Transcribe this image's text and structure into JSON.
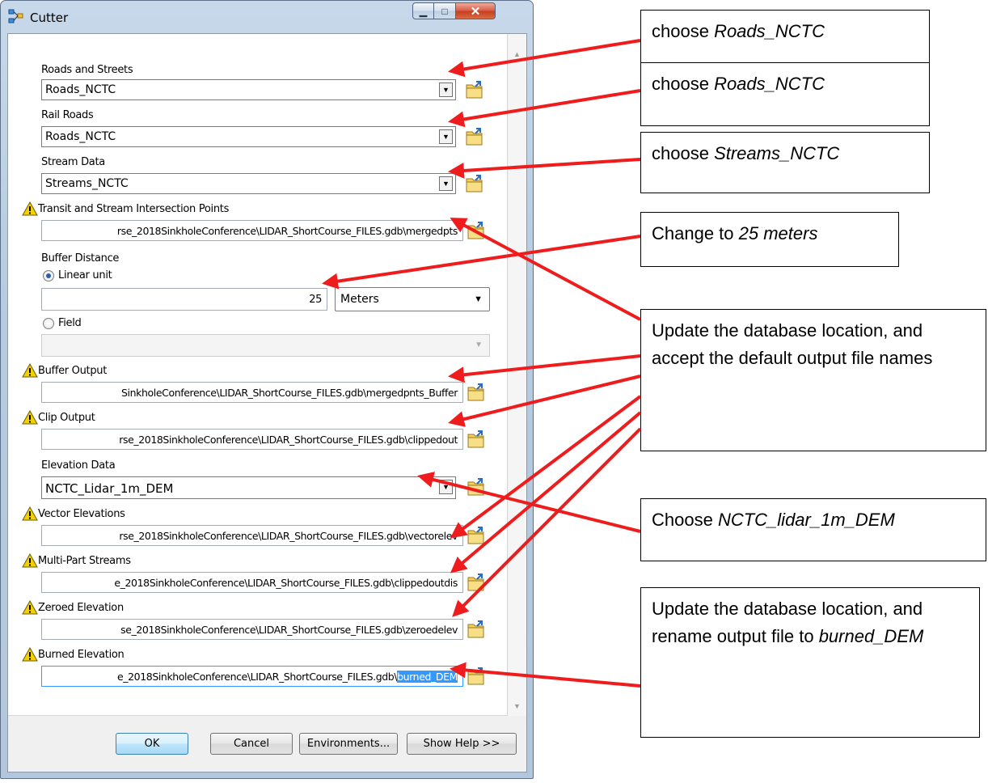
{
  "window": {
    "title": "Cutter",
    "minimize_glyph": "▁",
    "maximize_glyph": "□",
    "close_glyph": "✕"
  },
  "fields": {
    "roads_label": "Roads and Streets",
    "roads_value": "Roads_NCTC",
    "rail_label": "Rail Roads",
    "rail_value": "Roads_NCTC",
    "stream_label": "Stream Data",
    "stream_value": "Streams_NCTC",
    "intersection_label": "Transit and Stream Intersection Points",
    "intersection_value": "rse_2018SinkholeConference\\LIDAR_ShortCourse_FILES.gdb\\mergedpts",
    "buffer_distance_label": "Buffer Distance",
    "linear_unit_label": "Linear unit",
    "linear_unit_value": "25",
    "linear_unit_units": "Meters",
    "field_label": "Field",
    "buffer_output_label": "Buffer Output",
    "buffer_output_value": "SinkholeConference\\LIDAR_ShortCourse_FILES.gdb\\mergedpnts_Buffer",
    "clip_output_label": "Clip Output",
    "clip_output_value": "rse_2018SinkholeConference\\LIDAR_ShortCourse_FILES.gdb\\clippedout",
    "elevation_label": "Elevation Data",
    "elevation_value": "NCTC_Lidar_1m_DEM",
    "vector_elev_label": "Vector Elevations",
    "vector_elev_value": "rse_2018SinkholeConference\\LIDAR_ShortCourse_FILES.gdb\\vectorelev",
    "multipart_label": "Multi-Part Streams",
    "multipart_value": "e_2018SinkholeConference\\LIDAR_ShortCourse_FILES.gdb\\clippedoutdis",
    "zeroed_label": "Zeroed Elevation",
    "zeroed_value": "se_2018SinkholeConference\\LIDAR_ShortCourse_FILES.gdb\\zeroedelev",
    "burned_label": "Burned Elevation",
    "burned_value_prefix": "e_2018SinkholeConference\\LIDAR_ShortCourse_FILES.gdb\\",
    "burned_value_selected": "burned_DEM"
  },
  "buttons": {
    "ok": "OK",
    "cancel": "Cancel",
    "environments": "Environments...",
    "show_help": "Show Help >>"
  },
  "callouts": {
    "c1_prefix": "choose ",
    "c1_italic": "Roads_NCTC",
    "c2_prefix": "choose ",
    "c2_italic": "Roads_NCTC",
    "c3_prefix": "choose ",
    "c3_italic": "Streams_NCTC",
    "c4_prefix": "Change to ",
    "c4_italic": "25 meters",
    "c5_text": "Update the database location, and accept the default output file names",
    "c6_prefix": "Choose ",
    "c6_italic": "NCTC_lidar_1m_DEM",
    "c7_text": "Update the database location, and rename output file to ",
    "c7_italic": "burned_DEM"
  },
  "colors": {
    "arrow": "#ee1c1c",
    "selection": "#3399ff",
    "warning": "#f5d000"
  },
  "icons": {
    "app": "model-icon",
    "warning": "warning-icon",
    "browse": "folder-icon"
  }
}
